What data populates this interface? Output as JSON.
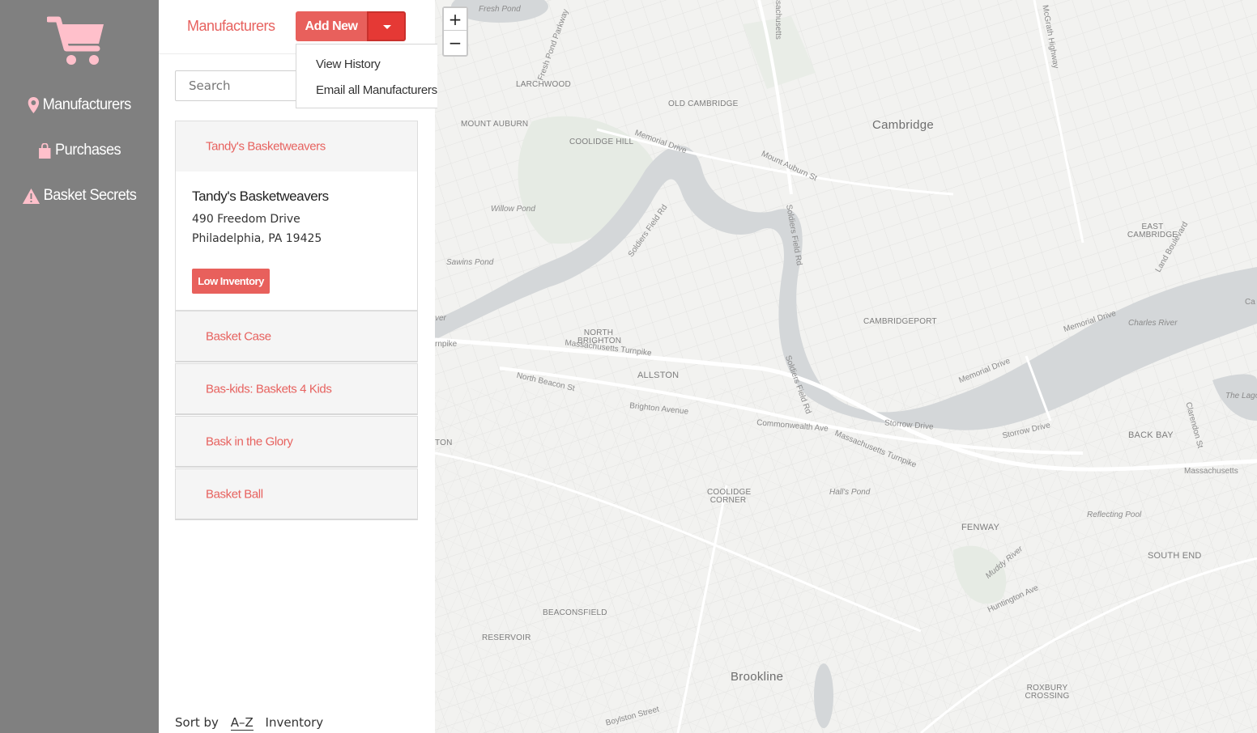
{
  "sidebar": {
    "logo_icon": "shopping-cart-icon",
    "accent_color": "#ffc0cb",
    "items": [
      {
        "label": "Manufacturers",
        "icon": "map-pin-icon"
      },
      {
        "label": "Purchases",
        "icon": "shopping-bag-icon"
      },
      {
        "label": "Basket Secrets",
        "icon": "warning-icon"
      }
    ]
  },
  "header": {
    "tab_label": "Manufacturers",
    "add_new_label": "Add New",
    "dropdown_items": [
      "View History",
      "Email all Manufacturers"
    ]
  },
  "search": {
    "placeholder": "Search",
    "value": ""
  },
  "manufacturers": [
    {
      "name": "Tandy's Basketweavers",
      "expanded": true
    },
    {
      "name": "Basket Case"
    },
    {
      "name": "Bas-kids: Baskets 4 Kids"
    },
    {
      "name": "Bask in the Glory"
    },
    {
      "name": "Basket Ball"
    }
  ],
  "detail": {
    "name": "Tandy's Basketweavers",
    "address_line1": "490 Freedom Drive",
    "address_line2": "Philadelphia, PA 19425",
    "badge": "Low Inventory"
  },
  "sort": {
    "label": "Sort by",
    "options": [
      "A–Z",
      "Inventory"
    ],
    "selected": "A–Z"
  },
  "map": {
    "zoom_in": "+",
    "zoom_out": "−",
    "labels": {
      "cambridge": "Cambridge",
      "brookline": "Brookline",
      "allston": "ALLSTON",
      "fenway": "FENWAY",
      "back_bay": "BACK BAY",
      "south_end": "SOUTH END",
      "cambridgeport": "CAMBRIDGEPORT",
      "east_cambridge": "EAST CAMBRIDGE",
      "north_brighton": "NORTH BRIGHTON",
      "coolidge_corner": "COOLIDGE CORNER",
      "beaconsfield": "BEACONSFIELD",
      "reservoir": "RESERVOIR",
      "roxbury_crossing": "ROXBURY CROSSING",
      "old_cambridge": "OLD CAMBRIDGE",
      "mount_auburn": "MOUNT AUBURN",
      "larchwood": "LARCHWOOD",
      "coolidge_hill": "COOLIDGE HILL",
      "fresh_pond": "Fresh Pond",
      "willow_pond": "Willow Pond",
      "sawins_pond": "Sawins Pond",
      "charles_river": "Charles River",
      "halls_pond": "Hall's Pond",
      "reflecting_pool": "Reflecting Pool",
      "the_lagoon": "The Lago",
      "massachusetts_turnpike": "Massachusetts Turnpike",
      "massachusetts_turnpike_2": "Massachusetts Turnpike",
      "memorial_drive": "Memorial Drive",
      "storrow_drive": "Storrow Drive",
      "commonwealth_ave": "Commonwealth Ave",
      "brighton_avenue": "Brighton Avenue",
      "north_beacon_st": "North Beacon St",
      "mount_auburn_st": "Mount Auburn St",
      "huntington_ave": "Huntington Ave",
      "boylston_street": "Boylston Street",
      "soldiers_field_rd": "Soldiers Field Rd",
      "land_boulevard": "Land Boulevard",
      "massachusetts_e": "Massachusetts",
      "massachusetts_ave_se": "Massachusetts",
      "mcgrath_highway": "McGrath Highway",
      "fresh_pond_parkway": "Fresh Pond Parkway",
      "muddy_river": "Muddy River",
      "clarendon_st": "Clarendon St",
      "ton": "TON",
      "arlington_partial": "Ca",
      "river_partial": "ver",
      "turnpike_partial": "rnpike"
    }
  }
}
